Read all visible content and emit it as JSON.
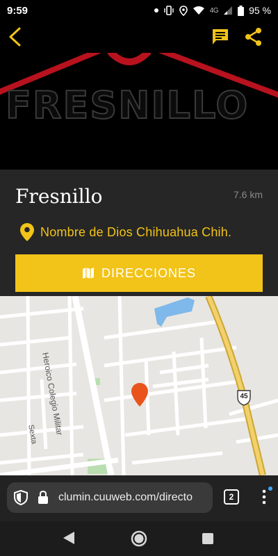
{
  "status_bar": {
    "time": "9:59",
    "network": "4G",
    "battery": "95 %"
  },
  "app_bar": {
    "back_icon": "chevron-left-icon",
    "message_icon": "message-icon",
    "share_icon": "share-icon",
    "accent_color": "#f2c318"
  },
  "hero": {
    "logo_text": "FRESNILLO"
  },
  "place": {
    "title": "Fresnillo",
    "distance": "7.6 km",
    "address": "Nombre de Dios Chihuahua Chih.",
    "directions_label": "DIRECCIONES"
  },
  "map": {
    "road_colegio": "Heroico Colegio Militar",
    "road_sexta": "Sexta",
    "highway_shield": "45",
    "marker_color": "#e8541c"
  },
  "browser": {
    "url": "clumin.cuuweb.com/directo",
    "tab_count": "2"
  }
}
